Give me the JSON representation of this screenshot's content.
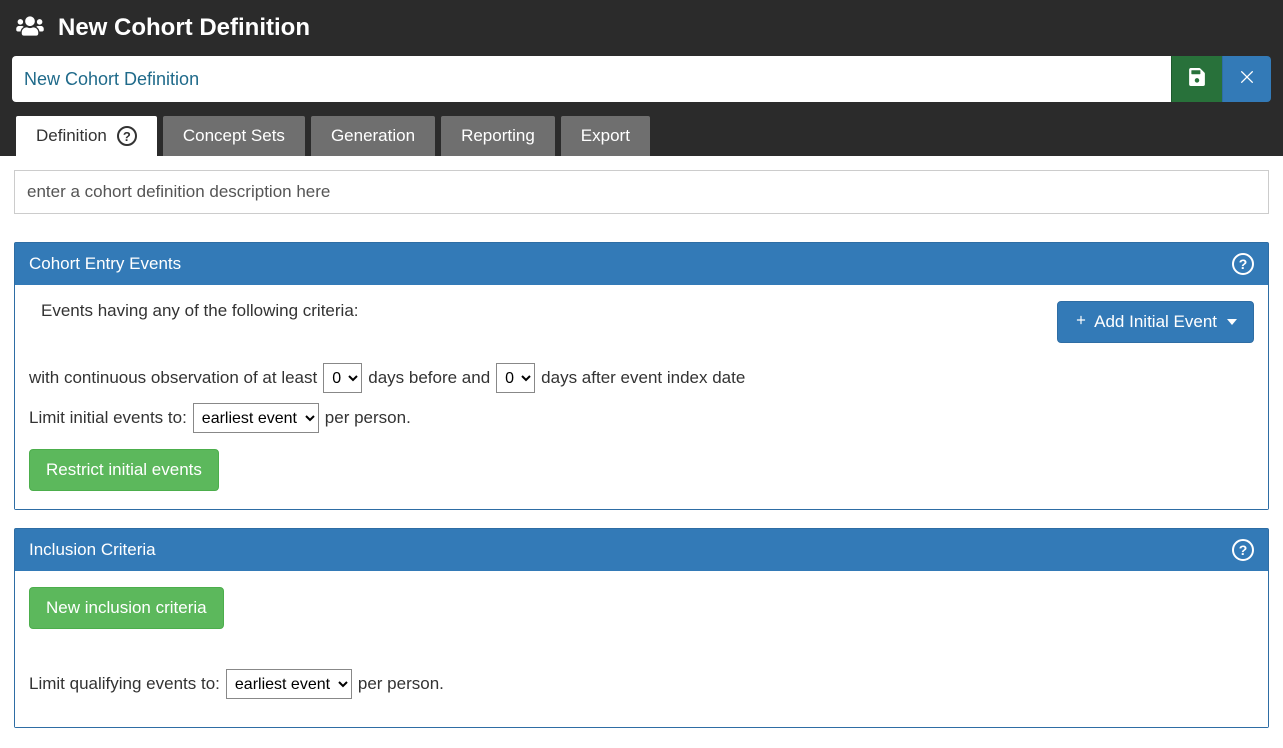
{
  "header": {
    "title": "New Cohort Definition",
    "name_value": "New Cohort Definition"
  },
  "tabs": {
    "definition": "Definition",
    "concept_sets": "Concept Sets",
    "generation": "Generation",
    "reporting": "Reporting",
    "export": "Export"
  },
  "description": {
    "placeholder": "enter a cohort definition description here"
  },
  "entry": {
    "panel_title": "Cohort Entry Events",
    "intro": "Events having any of the following criteria:",
    "add_button": "Add Initial Event",
    "obs_text_1": "with continuous observation of at least",
    "obs_days_before": "0",
    "obs_text_2": "days before and",
    "obs_days_after": "0",
    "obs_text_3": "days after event index date",
    "limit_text_1": "Limit initial events to:",
    "limit_select_value": "earliest event",
    "limit_text_2": "per person.",
    "restrict_button": "Restrict initial events"
  },
  "inclusion": {
    "panel_title": "Inclusion Criteria",
    "new_button": "New inclusion criteria",
    "limit_text_1": "Limit qualifying events to:",
    "limit_select_value": "earliest event",
    "limit_text_2": "per person."
  }
}
